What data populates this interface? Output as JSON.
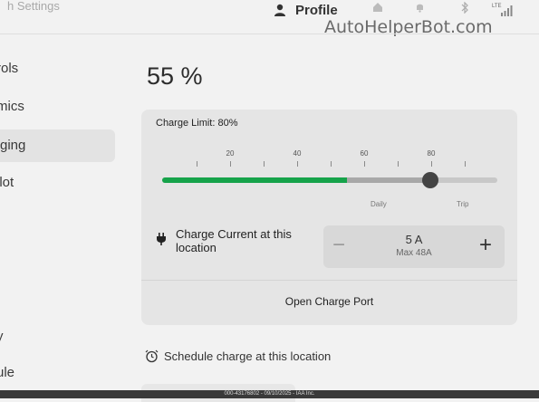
{
  "header": {
    "title": "h Settings",
    "profile_label": "Profile",
    "lte_label": "LTE"
  },
  "watermark": "AutoHelperBot.com",
  "sidebar": {
    "items": [
      {
        "label": "rols"
      },
      {
        "label": "mics"
      },
      {
        "label": "ging",
        "active": true
      },
      {
        "label": "ilot"
      },
      {
        "label": "y"
      },
      {
        "label": "ule"
      }
    ]
  },
  "charging": {
    "battery_percent": "55 %",
    "charge_limit_label": "Charge Limit: 80%",
    "charge_limit_value": 80,
    "current_charge_value": 55,
    "ticks": [
      "20",
      "40",
      "60",
      "80"
    ],
    "daily_label": "Daily",
    "trip_label": "Trip",
    "charge_current_label": "Charge Current at this location",
    "current_value": "5 A",
    "current_max": "Max 48A",
    "minus_label": "−",
    "plus_label": "+",
    "open_port_label": "Open Charge Port",
    "schedule_label": "Schedule charge at this location"
  },
  "footer": "000-43176802 - 09/10/2025 - IAA Inc.",
  "colors": {
    "accent": "#16a34a",
    "knob": "#444444"
  }
}
